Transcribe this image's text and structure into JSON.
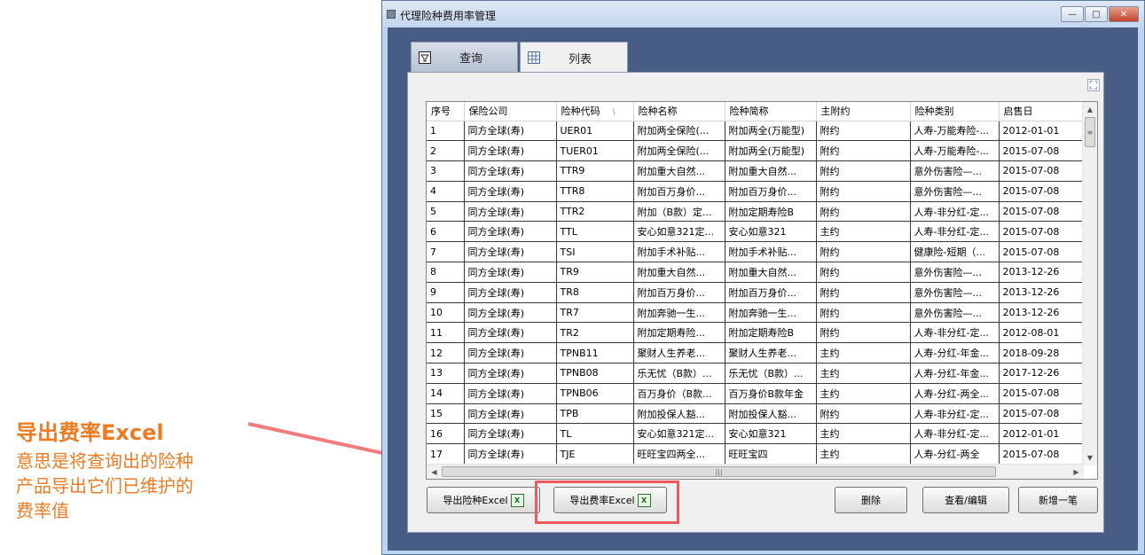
{
  "annotation": {
    "title": "导出费率Excel",
    "lines": [
      "意思是将查询出的险种",
      "产品导出它们已维护的",
      "费率值"
    ],
    "color": "#ee7b22",
    "arrow_color": "#f07c7c"
  },
  "window": {
    "title": "代理险种费用率管理",
    "buttons": {
      "minimize": "—",
      "maximize": "□",
      "close": "✕"
    }
  },
  "tabs": [
    {
      "label": "查询",
      "icon": "funnel-icon"
    },
    {
      "label": "列表",
      "icon": "grid-icon"
    }
  ],
  "table": {
    "columns": [
      "序号",
      "保险公司",
      "险种代码",
      "险种名称",
      "险种简称",
      "主附约",
      "险种类别",
      "启售日"
    ],
    "rows": [
      [
        "1",
        "同方全球(寿)",
        "UER01",
        "附加两全保险(...",
        "附加两全(万能型)",
        "附约",
        "人寿-万能寿险-...",
        "2012-01-01"
      ],
      [
        "2",
        "同方全球(寿)",
        "TUER01",
        "附加两全保险(...",
        "附加两全(万能型)",
        "附约",
        "人寿-万能寿险-...",
        "2015-07-08"
      ],
      [
        "3",
        "同方全球(寿)",
        "TTR9",
        "附加重大自然...",
        "附加重大自然...",
        "附约",
        "意外伤害险—...",
        "2015-07-08"
      ],
      [
        "4",
        "同方全球(寿)",
        "TTR8",
        "附加百万身价...",
        "附加百万身价...",
        "附约",
        "意外伤害险—...",
        "2015-07-08"
      ],
      [
        "5",
        "同方全球(寿)",
        "TTR2",
        "附加（B款）定...",
        "附加定期寿险B",
        "附约",
        "人寿-非分红-定...",
        "2015-07-08"
      ],
      [
        "6",
        "同方全球(寿)",
        "TTL",
        "安心如意321定...",
        "安心如意321",
        "主约",
        "人寿-非分红-定...",
        "2015-07-08"
      ],
      [
        "7",
        "同方全球(寿)",
        "TSI",
        "附加手术补贴...",
        "附加手术补贴...",
        "附约",
        "健康险-短期（...",
        "2015-07-08"
      ],
      [
        "8",
        "同方全球(寿)",
        "TR9",
        "附加重大自然...",
        "附加重大自然...",
        "附约",
        "意外伤害险—...",
        "2013-12-26"
      ],
      [
        "9",
        "同方全球(寿)",
        "TR8",
        "附加百万身价...",
        "附加百万身价...",
        "附约",
        "意外伤害险—...",
        "2013-12-26"
      ],
      [
        "10",
        "同方全球(寿)",
        "TR7",
        "附加奔驰一生...",
        "附加奔驰一生...",
        "附约",
        "意外伤害险—...",
        "2013-12-26"
      ],
      [
        "11",
        "同方全球(寿)",
        "TR2",
        "附加定期寿险...",
        "附加定期寿险B",
        "附约",
        "人寿-非分红-定...",
        "2012-08-01"
      ],
      [
        "12",
        "同方全球(寿)",
        "TPNB11",
        "聚财人生养老...",
        "聚财人生养老...",
        "主约",
        "人寿-分红-年金...",
        "2018-09-28"
      ],
      [
        "13",
        "同方全球(寿)",
        "TPNB08",
        "乐无忧（B款）...",
        "乐无忧（B款）...",
        "主约",
        "人寿-分红-年金...",
        "2017-12-26"
      ],
      [
        "14",
        "同方全球(寿)",
        "TPNB06",
        "百万身价（B款...",
        "百万身价B款年金",
        "主约",
        "人寿-分红-两全...",
        "2015-07-08"
      ],
      [
        "15",
        "同方全球(寿)",
        "TPB",
        "附加投保人豁...",
        "附加投保人豁...",
        "附约",
        "人寿-非分红-定...",
        "2015-07-08"
      ],
      [
        "16",
        "同方全球(寿)",
        "TL",
        "安心如意321定...",
        "安心如意321",
        "主约",
        "人寿-非分红-定...",
        "2012-01-01"
      ],
      [
        "17",
        "同方全球(寿)",
        "TJE",
        "旺旺宝四两全...",
        "旺旺宝四",
        "主约",
        "人寿-分红-两全",
        "2015-07-08"
      ]
    ]
  },
  "buttons": {
    "export_product": "导出险种Excel",
    "export_rate": "导出费率Excel",
    "delete": "删除",
    "view_edit": "查看/编辑",
    "add_new": "新增一笔"
  }
}
